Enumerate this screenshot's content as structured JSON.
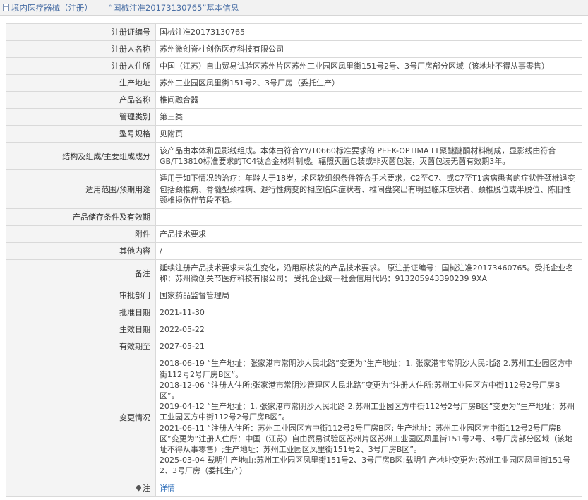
{
  "header": {
    "title": "境内医疗器械（注册）——“国械注准20173130765”基本信息"
  },
  "rows": [
    {
      "label": "注册证编号",
      "value": "国械注准20173130765"
    },
    {
      "label": "注册人名称",
      "value": "苏州微创脊柱创伤医疗科技有限公司"
    },
    {
      "label": "注册人住所",
      "value": "中国（江苏）自由贸易试验区苏州片区苏州工业园区凤里街151号2号、3号厂房部分区域（该地址不得从事零售）"
    },
    {
      "label": "生产地址",
      "value": "苏州工业园区凤里街151号2、3号厂房（委托生产）"
    },
    {
      "label": "产品名称",
      "value": "椎间融合器"
    },
    {
      "label": "管理类别",
      "value": "第三类"
    },
    {
      "label": "型号规格",
      "value": "见附页"
    },
    {
      "label": "结构及组成/主要组成成分",
      "value": "该产品由本体和显影线组成。本体由符合YY/T0660标准要求的 PEEK-OPTIMA LT聚醚醚酮材料制成，显影线由符合GB/T13810标准要求的TC4钛合金材料制成。辐照灭菌包装或非灭菌包装，灭菌包装无菌有效期3年。"
    },
    {
      "label": "适用范围/预期用途",
      "value": "适用于如下情况的治疗：年龄大于18岁，术区软组织条件符合手术要求，C2至C7、或C7至T1病病患者的症状性颈椎退变包括颈椎病、脊髓型颈椎病、退行性病变的相应临床症状者、椎间盘突出有明显临床症状者、颈椎脱位或半脱位、陈旧性颈椎损伤伴节段不稳。"
    },
    {
      "label": "产品储存条件及有效期",
      "value": ""
    },
    {
      "label": "附件",
      "value": "产品技术要求"
    },
    {
      "label": "其他内容",
      "value": "/"
    },
    {
      "label": "备注",
      "value": "延续注册产品技术要求未发生变化，沿用原核发的产品技术要求。 原注册证编号：国械注准20173460765。受托企业名称：苏州微创关节医疗科技有限公司； 受托企业统一社会信用代码：913205943390239 9XA"
    },
    {
      "label": "审批部门",
      "value": "国家药品监督管理局"
    },
    {
      "label": "批准日期",
      "value": "2021-11-30"
    },
    {
      "label": "生效日期",
      "value": "2022-05-22"
    },
    {
      "label": "有效期至",
      "value": "2027-05-21"
    }
  ],
  "changes": {
    "label": "变更情况",
    "items": [
      "2018-06-19 “生产地址：张家港市常阴沙人民北路”变更为“生产地址：1. 张家港市常阴沙人民北路 2.苏州工业园区方中街112号2号厂房B区”。",
      "2018-12-06 “注册人住所:张家港市常阴沙管理区人民北路”变更为“注册人住所:苏州工业园区方中街112号2号厂房B区”。",
      "2019-04-12 “生产地址：1. 张家港市常阴沙人民北路 2.苏州工业园区方中街112号2号厂房B区”变更为“生产地址：苏州工业园区方中街112号2号厂房B区”。",
      "2021-06-11 “注册人住所：苏州工业园区方中街112号2号厂房B区; 生产地址：苏州工业园区方中街112号2号厂房B区”变更为“注册人住所：中国（江苏）自由贸易试验区苏州片区苏州工业园区凤里街151号2号、3号厂房部分区域（该地址不得从事零售）;生产地址：苏州工业园区凤里街151号2、3号厂房B区”。",
      "2025-03-04 载明生产地由:苏州工业园区凤里街151号2、3号厂房B区;载明生产地址变更为:苏州工业园区凤里街151号2、3号厂房（委托生产）"
    ]
  },
  "footer": {
    "label": "注",
    "link": "详情"
  }
}
